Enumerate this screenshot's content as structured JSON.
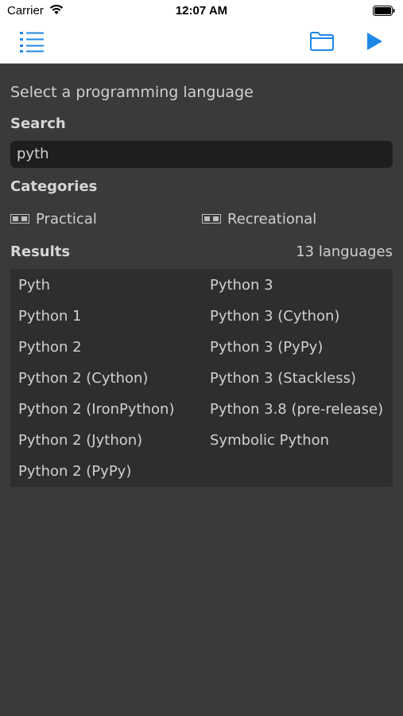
{
  "status": {
    "carrier": "Carrier",
    "time": "12:07 AM"
  },
  "nav": {
    "menu_icon": "list-icon",
    "folder_icon": "folder-icon",
    "run_icon": "play-icon",
    "accent": "#1e88e5"
  },
  "prompt": "Select a programming language",
  "search": {
    "label": "Search",
    "value": "pyth"
  },
  "categories": {
    "label": "Categories",
    "items": [
      "Practical",
      "Recreational"
    ]
  },
  "results": {
    "label": "Results",
    "count": "13 languages",
    "left_column": [
      "Pyth",
      "Python 1",
      "Python 2",
      "Python 2 (Cython)",
      "Python 2 (IronPython)",
      "Python 2 (Jython)",
      "Python 2 (PyPy)"
    ],
    "right_column": [
      "Python 3",
      "Python 3 (Cython)",
      "Python 3 (PyPy)",
      "Python 3 (Stackless)",
      "Python 3.8 (pre-release)",
      "Symbolic Python"
    ]
  }
}
